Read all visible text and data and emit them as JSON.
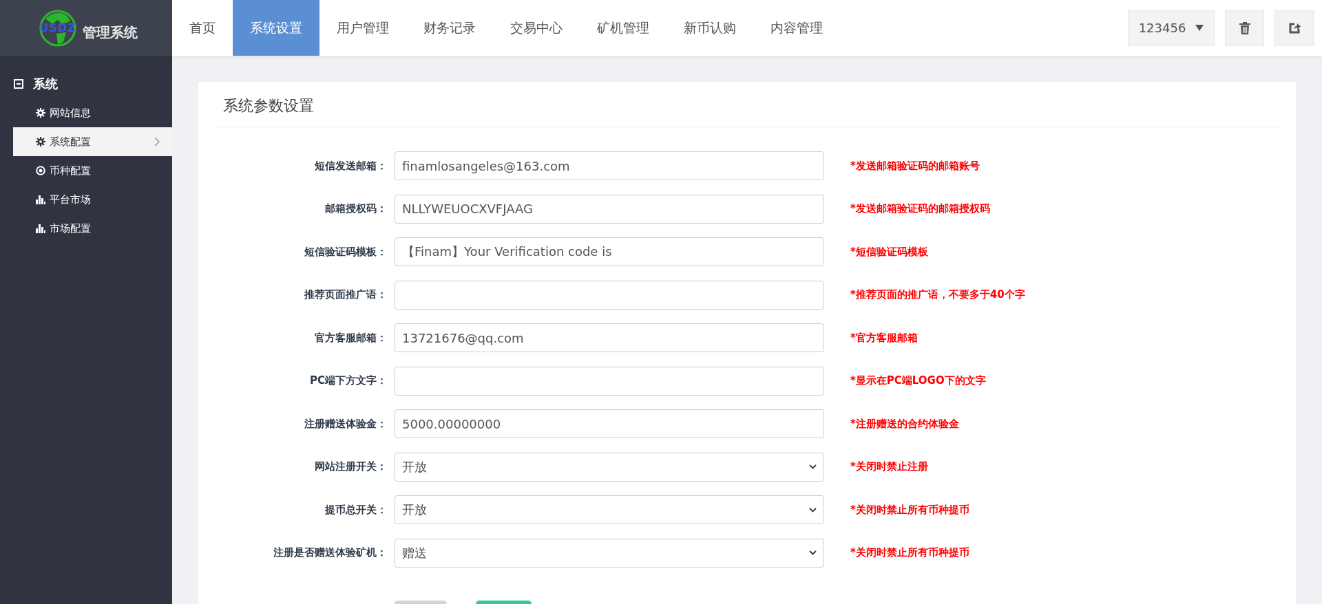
{
  "logo": {
    "mark": "USDZ",
    "title": "管理系统"
  },
  "nav_tabs": [
    {
      "label": "首页",
      "selected": false
    },
    {
      "label": "系统设置",
      "selected": true
    },
    {
      "label": "用户管理",
      "selected": false
    },
    {
      "label": "财务记录",
      "selected": false
    },
    {
      "label": "交易中心",
      "selected": false
    },
    {
      "label": "矿机管理",
      "selected": false
    },
    {
      "label": "新币认购",
      "selected": false
    },
    {
      "label": "内容管理",
      "selected": false
    }
  ],
  "user_menu": {
    "label": "123456"
  },
  "sidebar": {
    "group": {
      "label": "系统",
      "expanded": true
    },
    "items": [
      {
        "label": "网站信息",
        "kind": "gear",
        "selected": false
      },
      {
        "label": "系统配置",
        "kind": "gear",
        "selected": true
      },
      {
        "label": "币种配置",
        "kind": "circle",
        "selected": false
      },
      {
        "label": "平台市场",
        "kind": "chart",
        "selected": false
      },
      {
        "label": "市场配置",
        "kind": "chart",
        "selected": false
      }
    ]
  },
  "panel": {
    "title": "系统参数设置",
    "fields": [
      {
        "label": "短信发送邮箱：",
        "kind": "text",
        "value": "finamlosangeles@163.com",
        "hint": "*发送邮箱验证码的邮箱账号"
      },
      {
        "label": "邮箱授权码：",
        "kind": "text",
        "value": "NLLYWEUOCXVFJAAG",
        "hint": "*发送邮箱验证码的邮箱授权码"
      },
      {
        "label": "短信验证码模板：",
        "kind": "text",
        "value": "【Finam】Your Verification code is",
        "hint": "*短信验证码模板"
      },
      {
        "label": "推荐页面推广语：",
        "kind": "text",
        "hint": "*推荐页面的推广语，不要多于40个字"
      },
      {
        "label": "官方客服邮箱：",
        "kind": "text",
        "value": "13721676@qq.com",
        "hint": "*官方客服邮箱"
      },
      {
        "label": "PC端下方文字：",
        "kind": "text",
        "hint": "*显示在PC端LOGO下的文字"
      },
      {
        "label": "注册赠送体验金：",
        "kind": "text",
        "value": "5000.00000000",
        "hint": "*注册赠送的合约体验金"
      },
      {
        "label": "网站注册开关：",
        "kind": "select",
        "value": "开放",
        "hint": "*关闭时禁止注册"
      },
      {
        "label": "提币总开关：",
        "kind": "select",
        "value": "开放",
        "hint": "*关闭时禁止所有币种提币"
      },
      {
        "label": "注册是否赠送体验矿机：",
        "kind": "select",
        "value": "赠送",
        "hint": "*关闭时禁止所有币种提币"
      }
    ],
    "buttons": [
      {
        "kind": "secondary"
      },
      {
        "kind": "primary"
      }
    ]
  }
}
